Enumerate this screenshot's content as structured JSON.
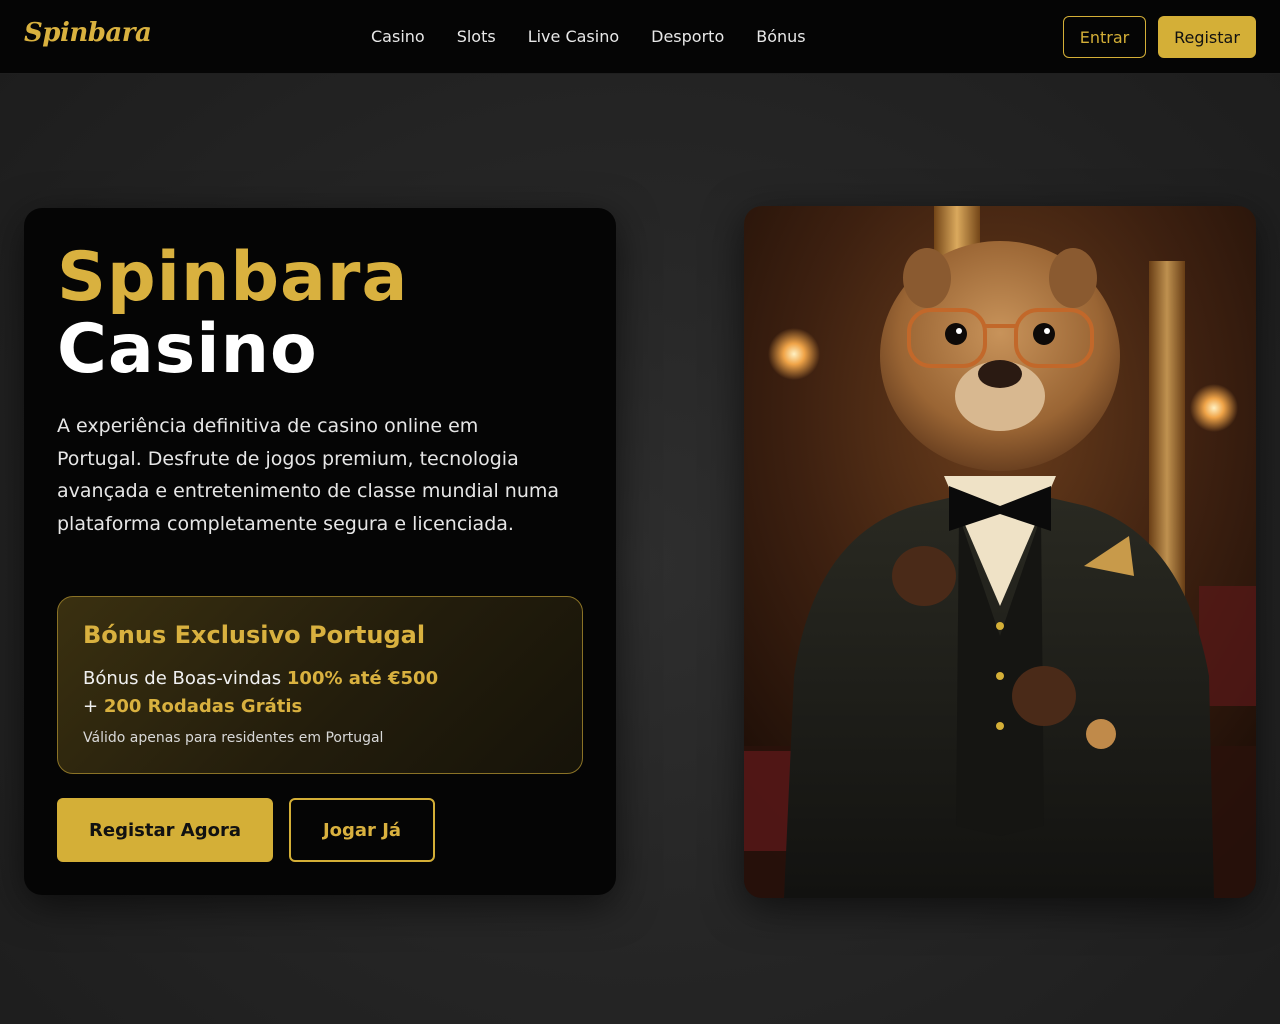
{
  "header": {
    "logo": "Spinbara",
    "nav": [
      "Casino",
      "Slots",
      "Live Casino",
      "Desporto",
      "Bónus"
    ],
    "login_label": "Entrar",
    "register_label": "Registar"
  },
  "hero": {
    "title_line1": "Spinbara",
    "title_line2": "Casino",
    "description": "A experiência definitiva de casino online em Portugal. Desfrute de jogos premium, tecnologia avançada e entretenimento de classe mundial numa plataforma completamente segura e licenciada.",
    "bonus": {
      "title": "Bónus Exclusivo Portugal",
      "prefix": "Bónus de Boas-vindas ",
      "highlight1": "100% até €500",
      "plus": "+ ",
      "highlight2": "200 Rodadas Grátis",
      "note": "Válido apenas para residentes em Portugal"
    },
    "cta_primary": "Registar Agora",
    "cta_secondary": "Jogar Já"
  },
  "image": {
    "description": "capybara-mascot-in-tuxedo"
  },
  "colors": {
    "accent": "#d4af37",
    "background": "#262626",
    "card": "#050505"
  }
}
